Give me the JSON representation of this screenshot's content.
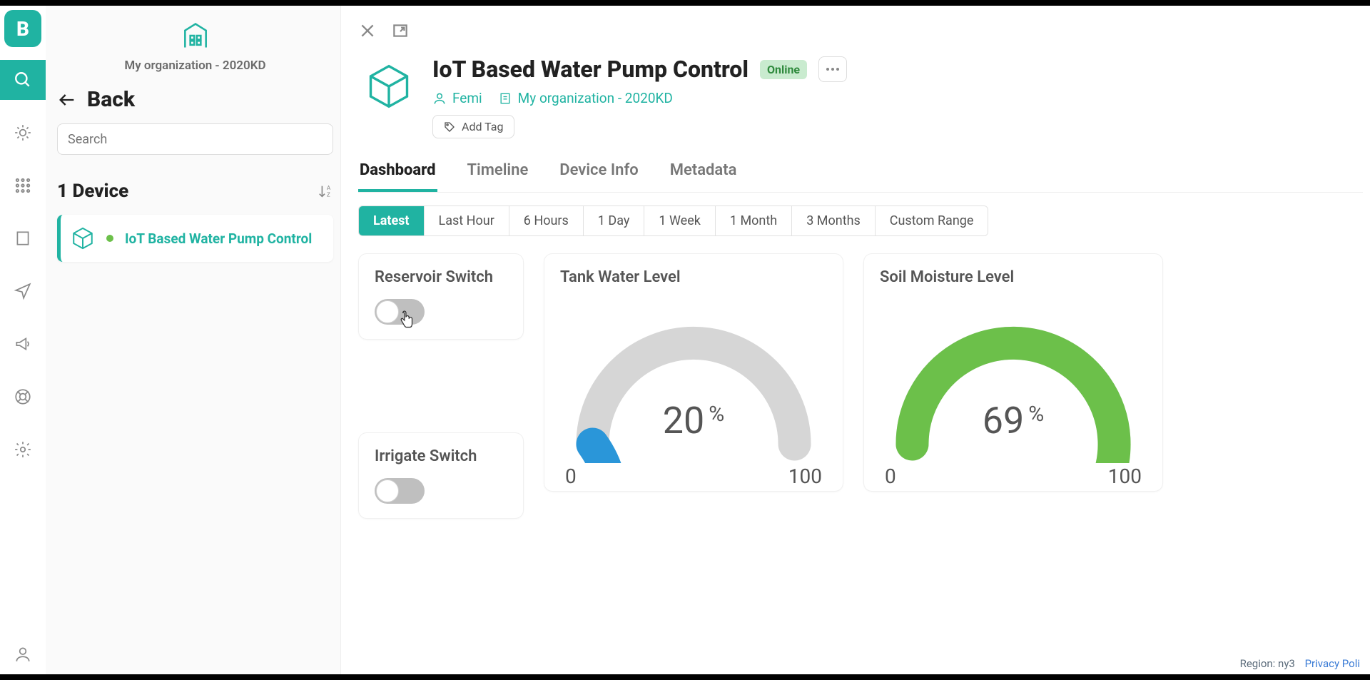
{
  "org": {
    "name": "My organization - 2020KD"
  },
  "sidebar": {
    "back_label": "Back",
    "search_placeholder": "Search",
    "device_count_label": "1 Device",
    "devices": [
      {
        "name": "IoT Based Water Pump Control",
        "online": true
      }
    ]
  },
  "device": {
    "title": "IoT Based Water Pump Control",
    "status": "Online",
    "owner": "Femi",
    "org": "My organization - 2020KD",
    "add_tag_label": "Add Tag"
  },
  "tabs": [
    "Dashboard",
    "Timeline",
    "Device Info",
    "Metadata"
  ],
  "active_tab": "Dashboard",
  "ranges": [
    "Latest",
    "Last Hour",
    "6 Hours",
    "1 Day",
    "1 Week",
    "1 Month",
    "3 Months",
    "Custom Range"
  ],
  "active_range": "Latest",
  "widgets": {
    "reservoir": {
      "title": "Reservoir Switch",
      "on": false
    },
    "irrigate": {
      "title": "Irrigate Switch",
      "on": false
    },
    "tank": {
      "title": "Tank Water Level",
      "value": 20,
      "unit": "%",
      "min": 0,
      "max": 100,
      "color": "#2a96d9"
    },
    "soil": {
      "title": "Soil Moisture Level",
      "value": 69,
      "unit": "%",
      "min": 0,
      "max": 100,
      "color": "#6cc04a"
    }
  },
  "footer": {
    "region_label": "Region: ny3",
    "privacy_label": "Privacy Poli"
  },
  "chart_data": [
    {
      "type": "gauge",
      "title": "Tank Water Level",
      "value": 20,
      "min": 0,
      "max": 100,
      "unit": "%"
    },
    {
      "type": "gauge",
      "title": "Soil Moisture Level",
      "value": 69,
      "min": 0,
      "max": 100,
      "unit": "%"
    }
  ]
}
